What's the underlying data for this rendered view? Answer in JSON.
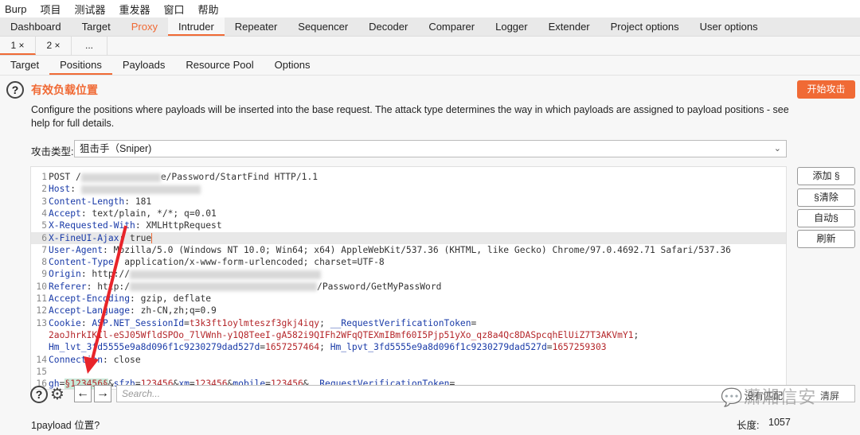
{
  "menu": [
    "Burp",
    "项目",
    "测试器",
    "重发器",
    "窗口",
    "帮助"
  ],
  "main_tabs": [
    "Dashboard",
    "Target",
    "Proxy",
    "Intruder",
    "Repeater",
    "Sequencer",
    "Decoder",
    "Comparer",
    "Logger",
    "Extender",
    "Project options",
    "User options"
  ],
  "active_main_tab": "Intruder",
  "sub_tabs": [
    "1 ×",
    "2 ×",
    "..."
  ],
  "intruder_tabs": [
    "Target",
    "Positions",
    "Payloads",
    "Resource Pool",
    "Options"
  ],
  "active_intruder_tab": "Positions",
  "section": {
    "title": "有效负载位置",
    "start_attack": "开始攻击",
    "description": "Configure the positions where payloads will be inserted into the base request. The attack type determines the way in which payloads are assigned to payload positions - see help for full details.",
    "attack_type_label": "攻击类型:",
    "attack_type_value": "狙击手（Sniper)"
  },
  "side_buttons": [
    "添加 §",
    "§清除",
    "自动§",
    "刷新"
  ],
  "request_lines": [
    {
      "n": "1",
      "t": [
        [
          "v",
          "POST /"
        ],
        [
          "blur",
          "100"
        ],
        [
          "v",
          "e/Password/StartFind HTTP/1.1"
        ]
      ]
    },
    {
      "n": "2",
      "t": [
        [
          "k",
          "Host"
        ],
        [
          "v",
          ": "
        ],
        [
          "blur",
          "150"
        ]
      ]
    },
    {
      "n": "3",
      "t": [
        [
          "k",
          "Content-Length"
        ],
        [
          "v",
          ": 181"
        ]
      ]
    },
    {
      "n": "4",
      "t": [
        [
          "k",
          "Accept"
        ],
        [
          "v",
          ": text/plain, */*; q=0.01"
        ]
      ]
    },
    {
      "n": "5",
      "t": [
        [
          "k",
          "X-Requested-With"
        ],
        [
          "v",
          ": XMLHttpRequest"
        ]
      ]
    },
    {
      "n": "6",
      "hl": true,
      "t": [
        [
          "k",
          "X-FineUI-Ajax"
        ],
        [
          "v",
          ": true"
        ],
        [
          "cursor",
          ""
        ]
      ]
    },
    {
      "n": "7",
      "t": [
        [
          "k",
          "User-Agent"
        ],
        [
          "v",
          ": Mozilla/5.0 (Windows NT 10.0; Win64; x64) AppleWebKit/537.36 (KHTML, like Gecko) Chrome/97.0.4692.71 Safari/537.36"
        ]
      ]
    },
    {
      "n": "8",
      "t": [
        [
          "k",
          "Content-Type"
        ],
        [
          "v",
          ": application/x-www-form-urlencoded; charset=UTF-8"
        ]
      ]
    },
    {
      "n": "9",
      "t": [
        [
          "k",
          "Origin"
        ],
        [
          "v",
          ": http://"
        ],
        [
          "blur",
          "240"
        ]
      ]
    },
    {
      "n": "10",
      "t": [
        [
          "k",
          "Referer"
        ],
        [
          "v",
          ": http:/"
        ],
        [
          "blur",
          "235"
        ],
        [
          "v",
          "/Password/GetMyPassWord"
        ]
      ]
    },
    {
      "n": "11",
      "t": [
        [
          "k",
          "Accept-Encoding"
        ],
        [
          "v",
          ": gzip, deflate"
        ]
      ]
    },
    {
      "n": "12",
      "t": [
        [
          "k",
          "Accept-Language"
        ],
        [
          "v",
          ": zh-CN,zh;q=0.9"
        ]
      ]
    },
    {
      "n": "13",
      "t": [
        [
          "k",
          "Cookie"
        ],
        [
          "v",
          ": "
        ],
        [
          "cn",
          "ASP.NET_SessionId"
        ],
        [
          "v",
          "="
        ],
        [
          "cv",
          "t3k3ft1oylmteszf3gkj4iqy"
        ],
        [
          "v",
          "; "
        ],
        [
          "cn",
          "__RequestVerificationToken"
        ],
        [
          "v",
          "="
        ]
      ]
    },
    {
      "n": "",
      "t": [
        [
          "cv",
          "2aoJhrkIKIl-eSJ05WfldSPOo_7lVWnh-y1Q8TeeI-gA582i9QIFh2WFqQTEXmIBmf60I5Pjp51yXo_qz8a4Qc8DASpcqhElUiZ7T3AKVmY1"
        ],
        [
          "v",
          ";"
        ]
      ]
    },
    {
      "n": "",
      "t": [
        [
          "cn",
          "Hm_lvt_3fd5555e9a8d096f1c9230279dad527d"
        ],
        [
          "v",
          "="
        ],
        [
          "cv",
          "1657257464"
        ],
        [
          "v",
          "; "
        ],
        [
          "cn",
          "Hm_lpvt_3fd5555e9a8d096f1c9230279dad527d"
        ],
        [
          "v",
          "="
        ],
        [
          "cv",
          "1657259303"
        ]
      ]
    },
    {
      "n": "14",
      "t": [
        [
          "k",
          "Connection"
        ],
        [
          "v",
          ": close"
        ]
      ]
    },
    {
      "n": "15",
      "t": []
    },
    {
      "n": "16",
      "t": [
        [
          "cn",
          "gh"
        ],
        [
          "v",
          "="
        ],
        [
          "mark",
          "§123456§"
        ],
        [
          "v",
          "&"
        ],
        [
          "cn",
          "sfzh"
        ],
        [
          "v",
          "="
        ],
        [
          "cv",
          "123456"
        ],
        [
          "v",
          "&"
        ],
        [
          "cn",
          "xm"
        ],
        [
          "v",
          "="
        ],
        [
          "cv",
          "123456"
        ],
        [
          "v",
          "&"
        ],
        [
          "cn",
          "mobile"
        ],
        [
          "v",
          "="
        ],
        [
          "cv",
          "123456"
        ],
        [
          "v",
          "&"
        ],
        [
          "cn",
          "__RequestVerificationToken"
        ],
        [
          "v",
          "="
        ]
      ]
    }
  ],
  "search": {
    "placeholder": "Search...",
    "matches": "没有匹配",
    "clear": "清屏"
  },
  "status": {
    "payload_positions": "1payload 位置?",
    "length_label": "长度:",
    "length_value": "1057"
  },
  "watermark": "潇湘信安",
  "colors": {
    "accent": "#f06a35",
    "header_key": "#1a3ba8",
    "param_value": "#b4262a",
    "arrow": "#e8242a"
  }
}
